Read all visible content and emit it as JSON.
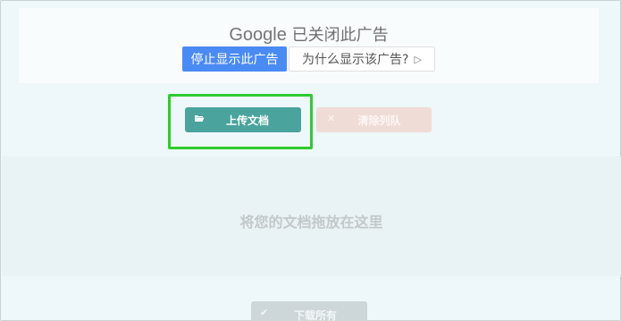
{
  "ad": {
    "brand": "Google",
    "closed_text": "已关闭此广告",
    "stop_button": "停止显示此广告",
    "why_button": "为什么显示该广告?",
    "why_icon": "▷"
  },
  "actions": {
    "upload_label": "上传文档",
    "upload_icon": "folder-open-icon",
    "clear_label": "清除列队",
    "clear_icon": "close-icon",
    "download_label": "下载所有",
    "download_icon": "check-icon"
  },
  "dropzone": {
    "text": "将您的文档拖放在这里"
  },
  "colors": {
    "upload_bg": "#4aa39d",
    "clear_bg": "#f0dcd7",
    "ad_blue": "#4a8af4",
    "highlight": "#2ecc2e"
  }
}
